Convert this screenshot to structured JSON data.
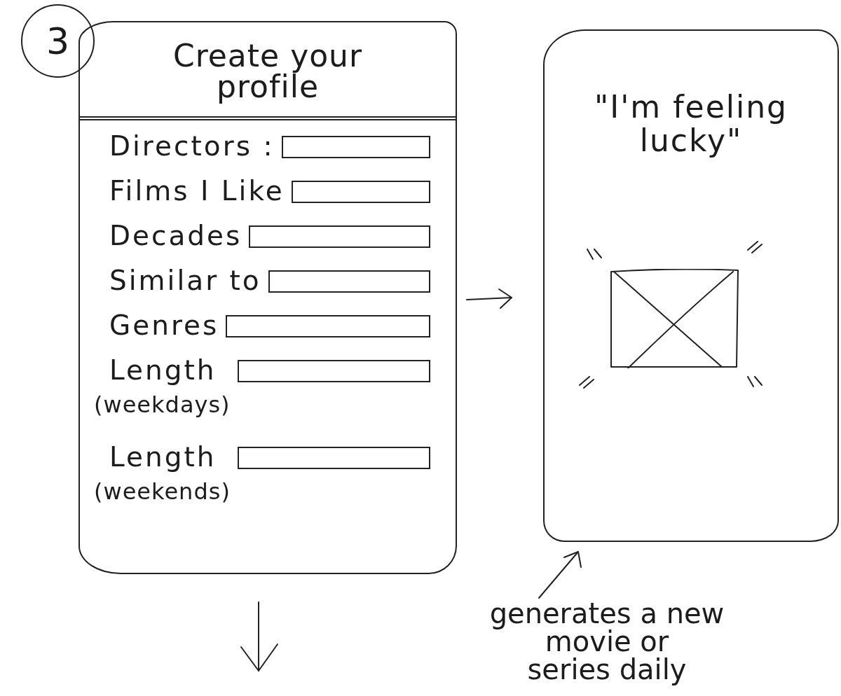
{
  "step_number": "3",
  "profile_screen": {
    "title": "Create your profile",
    "fields": [
      {
        "label": "Directors :"
      },
      {
        "label": "Films I Like"
      },
      {
        "label": "Decades"
      },
      {
        "label": "Similar to"
      },
      {
        "label": "Genres"
      },
      {
        "label": "Length",
        "note": "(weekdays)"
      },
      {
        "label": "Length",
        "note": "(weekends)"
      }
    ]
  },
  "lucky_screen": {
    "title": "\"I'm feeling lucky\""
  },
  "annotation": {
    "lines": [
      "generates a new",
      "movie or",
      "series daily"
    ]
  }
}
